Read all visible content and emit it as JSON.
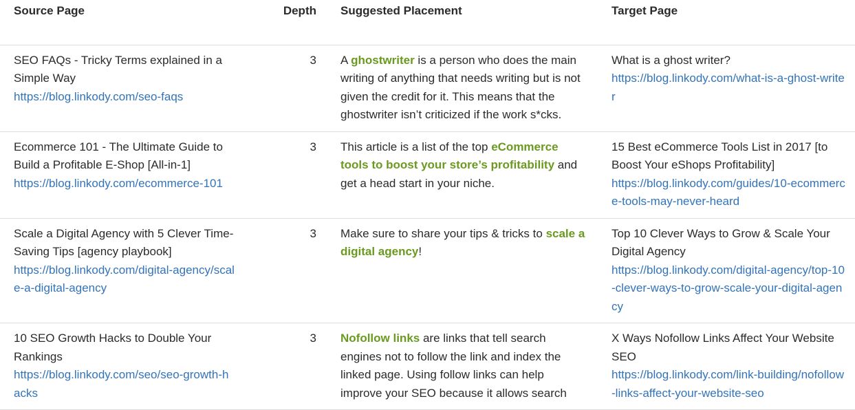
{
  "columns": {
    "source": "Source Page",
    "depth": "Depth",
    "placement": "Suggested Placement",
    "target": "Target Page"
  },
  "rows": [
    {
      "source_title": "SEO FAQs - Tricky Terms explained in a Simple Way",
      "source_url": "https://blog.linkody.com/seo-faqs",
      "depth": "3",
      "placement_pre": "A ",
      "placement_anchor": "ghostwriter",
      "placement_post": " is a person who does the main writing of anything that needs writing but is not given the credit for it. This means that the ghostwriter isn’t criticized if the work s*cks.",
      "target_title": "What is a ghost writer?",
      "target_url": "https://blog.linkody.com/what-is-a-ghost-writer"
    },
    {
      "source_title": "Ecommerce 101 - The Ultimate Guide to Build a Profitable E-Shop [All-in-1]",
      "source_url": "https://blog.linkody.com/ecommerce-101",
      "depth": "3",
      "placement_pre": "This article is a list of the top ",
      "placement_anchor": "eCommerce tools to boost your store’s profitability",
      "placement_post": " and get a head start in your niche.",
      "target_title": "15 Best eCommerce Tools List in 2017 [to Boost Your eShops Profitability]",
      "target_url": "https://blog.linkody.com/guides/10-ecommerce-tools-may-never-heard"
    },
    {
      "source_title": "Scale a Digital Agency with 5 Clever Time-Saving Tips [agency playbook]",
      "source_url": "https://blog.linkody.com/digital-agency/scale-a-digital-agency",
      "depth": "3",
      "placement_pre": "Make sure to share your tips & tricks to ",
      "placement_anchor": "scale a digital agency",
      "placement_post": "!",
      "target_title": "Top 10 Clever Ways to Grow & Scale Your Digital Agency",
      "target_url": "https://blog.linkody.com/digital-agency/top-10-clever-ways-to-grow-scale-your-digital-agency"
    },
    {
      "source_title": "10 SEO Growth Hacks to Double Your Rankings",
      "source_url": "https://blog.linkody.com/seo/seo-growth-hacks",
      "depth": "3",
      "placement_pre": "",
      "placement_anchor": "Nofollow links",
      "placement_post": " are links that tell search engines not to follow the link and index the linked page. Using follow links can help improve your SEO because it allows search",
      "target_title": "X Ways Nofollow Links Affect Your Website SEO",
      "target_url": "https://blog.linkody.com/link-building/nofollow-links-affect-your-website-seo"
    }
  ],
  "colors": {
    "link": "#3373b8",
    "anchor": "#6a9a1f",
    "text": "#2b2b2b"
  }
}
